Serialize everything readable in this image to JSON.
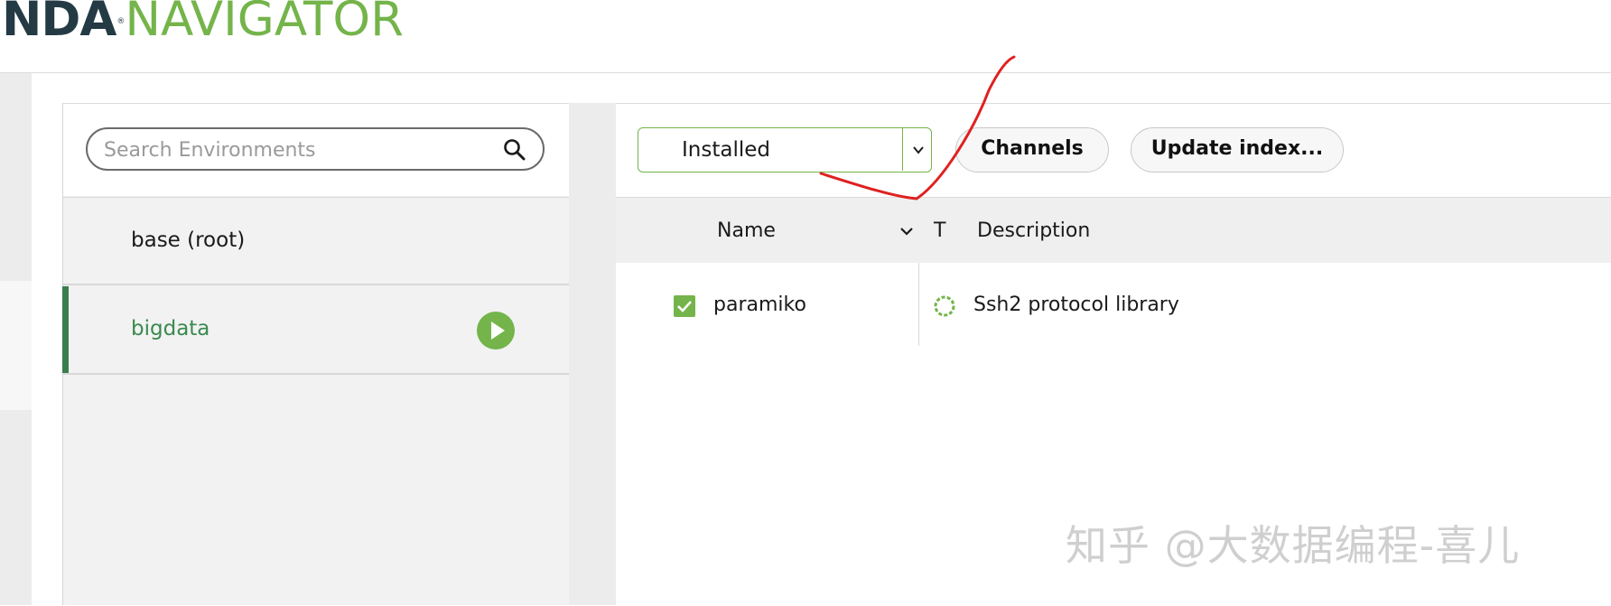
{
  "header": {
    "logo_dark": "NDA",
    "logo_reg": "®",
    "logo_green": "NAVIGATOR"
  },
  "environments": {
    "search": {
      "placeholder": "Search Environments",
      "icon": "search-icon"
    },
    "items": [
      {
        "label": "base (root)",
        "active": false
      },
      {
        "label": "bigdata",
        "active": true,
        "action_icon": "play-icon"
      }
    ]
  },
  "packages": {
    "filter": {
      "selected": "Installed",
      "icon": "chevron-down-icon"
    },
    "buttons": {
      "channels": "Channels",
      "update_index": "Update index..."
    },
    "columns": {
      "name": "Name",
      "type": "T",
      "description": "Description"
    },
    "rows": [
      {
        "checked": true,
        "name": "paramiko",
        "type_icon": "conda-package-icon",
        "description": "Ssh2 protocol library"
      }
    ]
  },
  "watermark": "知乎 @大数据编程-喜儿",
  "colors": {
    "brand_green": "#74b44a",
    "brand_dark": "#243a44",
    "active_bar": "#3a7d4c",
    "annotation_red": "#e02020"
  }
}
